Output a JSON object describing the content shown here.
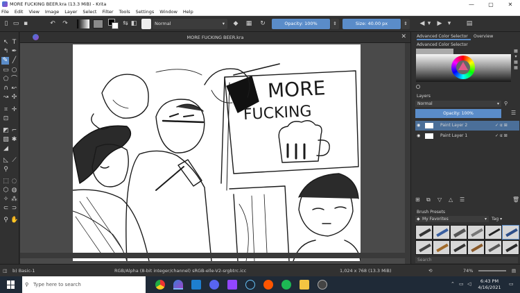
{
  "window": {
    "title": "MORE FUCKING BEER.kra (13.3 MiB)  - Krita",
    "controls": [
      "—",
      "▢",
      "✕"
    ]
  },
  "menu": [
    "File",
    "Edit",
    "View",
    "Image",
    "Layer",
    "Select",
    "Filter",
    "Tools",
    "Settings",
    "Window",
    "Help"
  ],
  "toolbar": {
    "blend_mode": "Normal",
    "opacity_label": "Opacity: 100%",
    "size_label": "Size: 40.00 px"
  },
  "document": {
    "tab_title": "MORE FUCKING BEER.kra",
    "sign_line1": "MORE",
    "sign_line2": "FUCKING"
  },
  "dock": {
    "tabs": [
      "Advanced Color Selector",
      "Overview"
    ],
    "color_selector_title": "Advanced Color Selector",
    "layers_title": "Layers",
    "layers_blend": "Normal",
    "layers_opacity": "Opacity:  100%",
    "layers": [
      {
        "name": "Paint Layer 2",
        "selected": true
      },
      {
        "name": "Paint Layer 1",
        "selected": false
      }
    ],
    "brush_presets_title": "Brush Presets",
    "brush_tag": "My Favorites",
    "brush_tag_label": "Tag",
    "brush_search_placeholder": "Search"
  },
  "status": {
    "brush": "b) Basic-1",
    "color_space": "RGB/Alpha (8-bit integer/channel)  sRGB-elle-V2-srgbtrc.icc",
    "dimensions": "1,024 x 768 (13.3 MiB)",
    "zoom": "74%"
  },
  "taskbar": {
    "search_placeholder": "Type here to search",
    "time": "6:43 PM",
    "date": "4/16/2021"
  },
  "colors": {
    "accent": "#5a8cc9",
    "panel": "#313131",
    "taskbar": "#1f2a37"
  }
}
